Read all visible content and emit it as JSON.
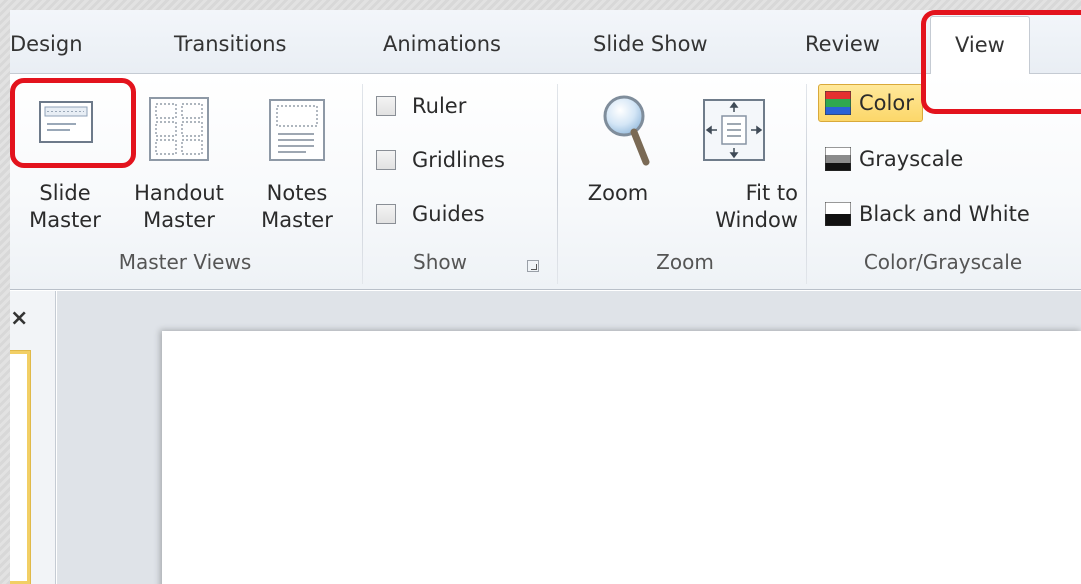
{
  "tabs": [
    {
      "label": "Design"
    },
    {
      "label": "Transitions"
    },
    {
      "label": "Animations"
    },
    {
      "label": "Slide Show"
    },
    {
      "label": "Review"
    },
    {
      "label": "View"
    }
  ],
  "active_tab": "View",
  "groups": {
    "master_views": {
      "label": "Master Views",
      "buttons": [
        {
          "label": "Slide\nMaster",
          "icon": "slide-master-icon"
        },
        {
          "label": "Handout\nMaster",
          "icon": "handout-master-icon"
        },
        {
          "label": "Notes\nMaster",
          "icon": "notes-master-icon"
        }
      ]
    },
    "show": {
      "label": "Show",
      "checkboxes": [
        {
          "label": "Ruler",
          "checked": false
        },
        {
          "label": "Gridlines",
          "checked": false
        },
        {
          "label": "Guides",
          "checked": false
        }
      ]
    },
    "zoom": {
      "label": "Zoom",
      "buttons": [
        {
          "label": "Zoom",
          "icon": "magnifier-icon"
        },
        {
          "label": "Fit to\nWindow",
          "icon": "fit-to-window-icon"
        }
      ]
    },
    "color_grayscale": {
      "label": "Color/Grayscale",
      "options": [
        {
          "label": "Color",
          "selected": true,
          "icon": "color-swatch-icon"
        },
        {
          "label": "Grayscale",
          "selected": false,
          "icon": "grayscale-swatch-icon"
        },
        {
          "label": "Black and White",
          "selected": false,
          "icon": "black-white-swatch-icon"
        }
      ]
    }
  },
  "pane": {
    "close_glyph": "×"
  },
  "colors": {
    "annotation": "#e3131d",
    "selected_bg": "#fcd76a",
    "thumb_border": "#f2cf65"
  }
}
